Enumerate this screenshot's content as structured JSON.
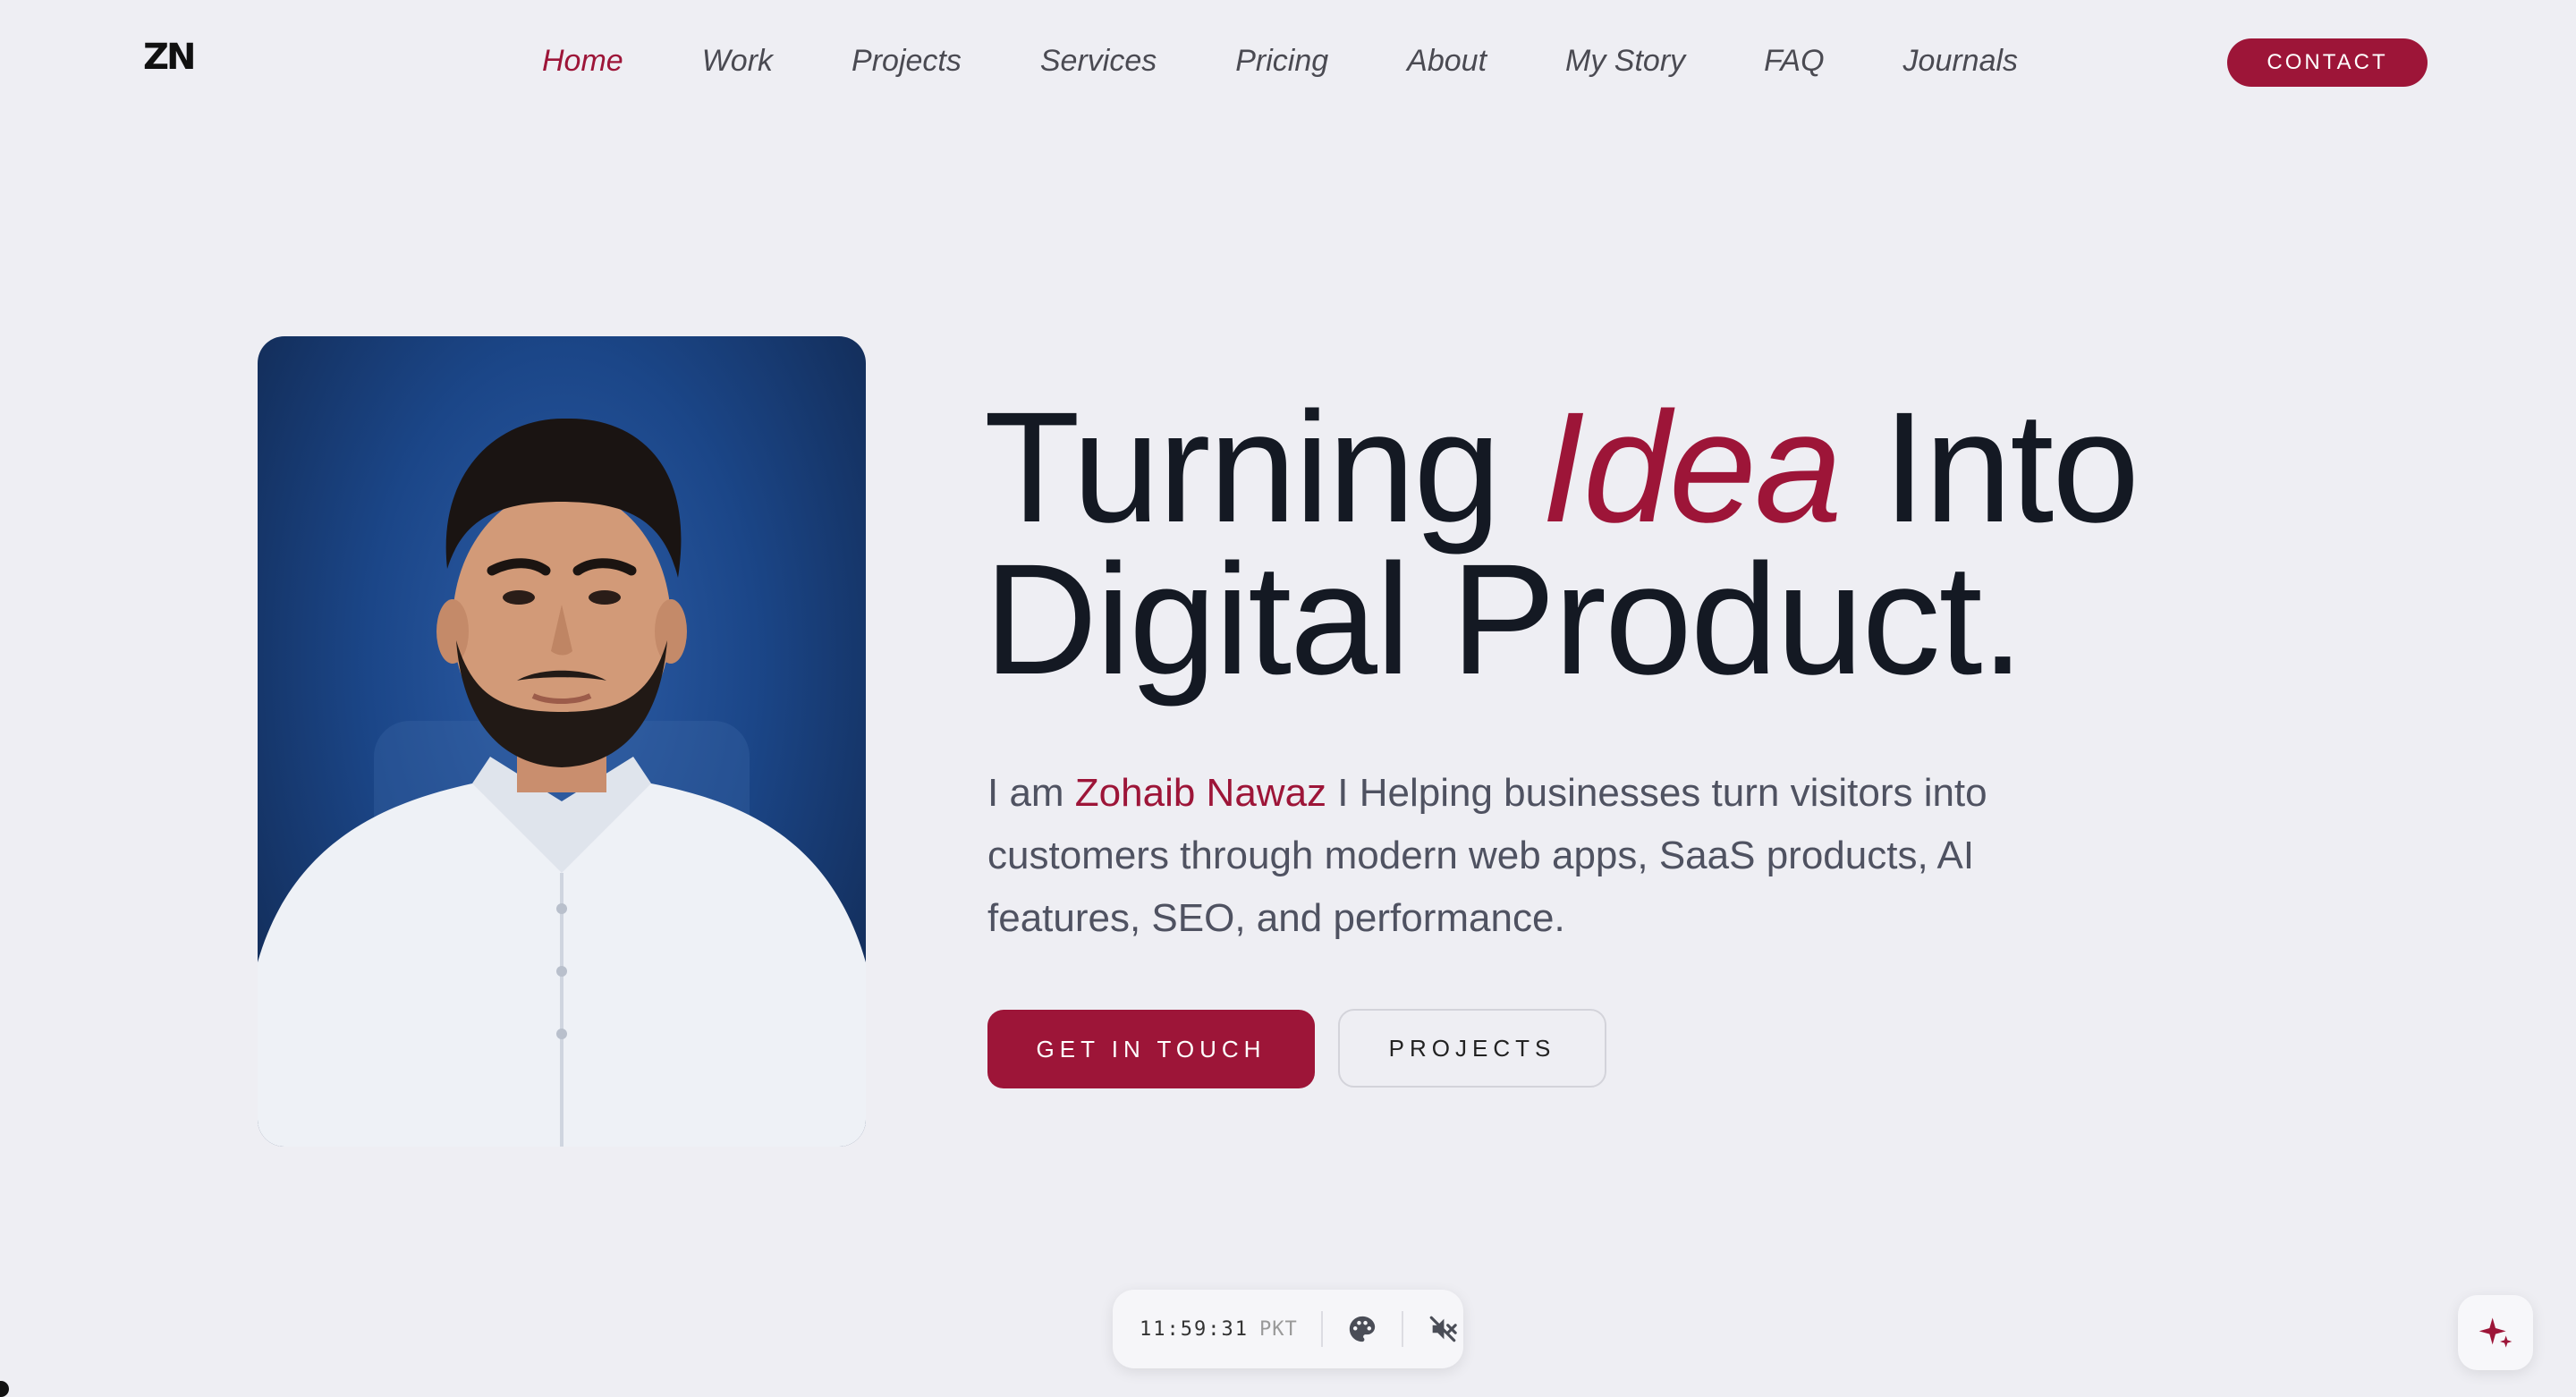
{
  "brand": {
    "logo_text": "ZN"
  },
  "nav": {
    "items": [
      {
        "label": "Home",
        "active": true
      },
      {
        "label": "Work"
      },
      {
        "label": "Projects"
      },
      {
        "label": "Services"
      },
      {
        "label": "Pricing"
      },
      {
        "label": "About"
      },
      {
        "label": "My Story"
      },
      {
        "label": "FAQ"
      },
      {
        "label": "Journals"
      }
    ],
    "contact_label": "CONTACT"
  },
  "hero": {
    "headline_part1": "Turning ",
    "headline_accent": "Idea",
    "headline_part2": " Into",
    "headline_line2": "Digital Product.",
    "intro_prefix": "I am ",
    "intro_name": "Zohaib Nawaz",
    "intro_rest": " I Helping businesses turn visitors into customers through modern web apps, SaaS products, AI features, SEO, and performance.",
    "primary_button": "GET IN TOUCH",
    "secondary_button": "PROJECTS"
  },
  "status_bar": {
    "time": "11:59:31",
    "timezone": "PKT",
    "icons": [
      "palette-icon",
      "sound-off-icon"
    ]
  },
  "assistant": {
    "icon": "sparkle-icon"
  },
  "colors": {
    "accent": "#9d1538",
    "background": "#eeeef3",
    "text": "#151a24",
    "muted_text": "#4f5261"
  }
}
